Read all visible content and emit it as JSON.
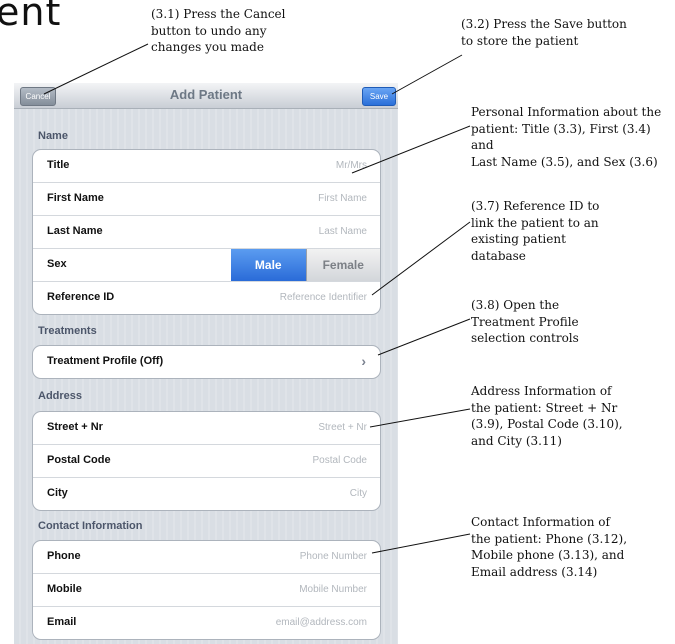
{
  "slide": {
    "title_fragment": "ent"
  },
  "annotations": {
    "a31": "(3.1) Press the Cancel\nbutton to undo any\nchanges you made",
    "a32": "(3.2) Press the Save button\nto store the patient",
    "a33": "Personal Information about the\npatient: Title (3.3), First (3.4) and\nLast Name (3.5), and Sex (3.6)",
    "a37": "(3.7) Reference ID to\nlink the patient to an\nexisting patient\ndatabase",
    "a38": "(3.8) Open the\nTreatment Profile\nselection controls",
    "a39": "Address Information of\nthe patient: Street + Nr\n(3.9), Postal Code (3.10),\nand City (3.11)",
    "a312": "Contact Information of\nthe patient: Phone (3.12),\nMobile phone (3.13), and\nEmail address (3.14)"
  },
  "navbar": {
    "title": "Add Patient",
    "cancel_label": "Cancel",
    "save_label": "Save"
  },
  "sections": {
    "name": {
      "label": "Name",
      "title": {
        "label": "Title",
        "placeholder": "Mr/Mrs"
      },
      "first_name": {
        "label": "First Name",
        "placeholder": "First Name"
      },
      "last_name": {
        "label": "Last Name",
        "placeholder": "Last Name"
      },
      "sex": {
        "label": "Sex",
        "options": [
          "Male",
          "Female"
        ],
        "selected": "Male"
      },
      "reference_id": {
        "label": "Reference ID",
        "placeholder": "Reference Identifier"
      }
    },
    "treatments": {
      "label": "Treatments",
      "profile": {
        "label": "Treatment Profile (Off)"
      }
    },
    "address": {
      "label": "Address",
      "street": {
        "label": "Street + Nr",
        "placeholder": "Street + Nr"
      },
      "postal": {
        "label": "Postal Code",
        "placeholder": "Postal Code"
      },
      "city": {
        "label": "City",
        "placeholder": "City"
      }
    },
    "contact": {
      "label": "Contact Information",
      "phone": {
        "label": "Phone",
        "placeholder": "Phone Number"
      },
      "mobile": {
        "label": "Mobile",
        "placeholder": "Mobile Number"
      },
      "email": {
        "label": "Email",
        "placeholder": "email@address.com"
      }
    }
  },
  "colors": {
    "accent": "#2a6bd8",
    "nav_title": "#6d7885",
    "placeholder": "#b2b7bd"
  }
}
